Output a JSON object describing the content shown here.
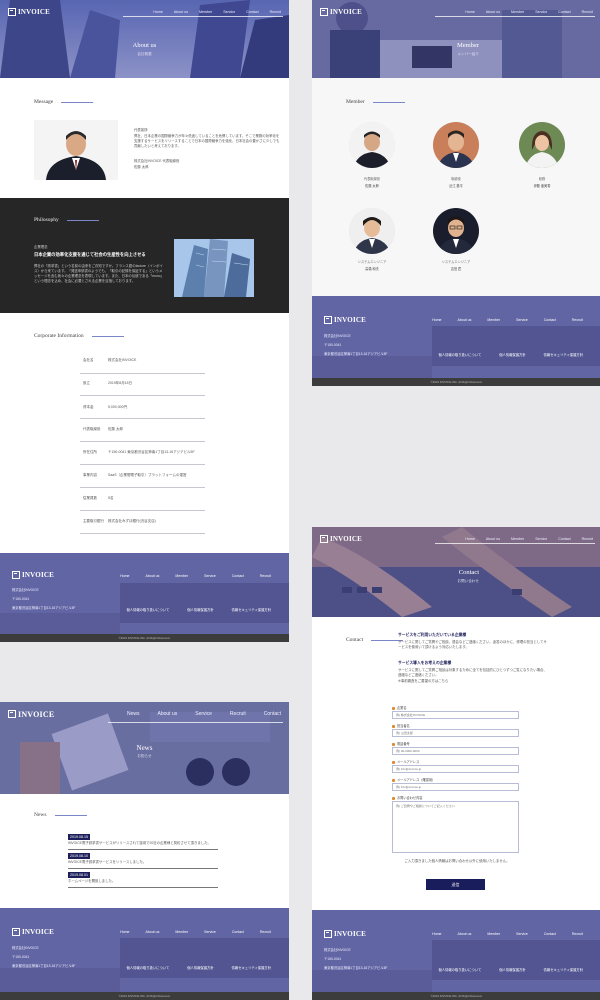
{
  "brand": {
    "logo": "INVOICE"
  },
  "nav": [
    "Home",
    "About us",
    "Member",
    "Service",
    "Contact",
    "Recruit"
  ],
  "nav_news": [
    "News",
    "About us",
    "Service",
    "Recruit",
    "Contact"
  ],
  "about": {
    "hero_title": "About us",
    "hero_sub": "会社概要",
    "message_heading": "Message",
    "message_paragraphs": [
      "代表挨拶",
      "弊社、日本企業の国際競争力が年々低迷していることを危惧しています。そこで業務の効率化を支援するサービスをリリースすることで日本の国際競争力を強化、日本社会の豊かさに少しでも貢献したいと考えております。",
      "株式会社INVOICE 代表取締役",
      "佐藤 太郎"
    ],
    "philosophy_heading": "Philosophy",
    "philosophy_label": "企業理念",
    "philosophy_title": "日本企業の効率化支援を通じて社会の生産性を向上させる",
    "philosophy_body": "弊社の「請求書」という名前の由来をご存知ですか。フランス語のfacture（インボイス）から来ています。「発送申請書のようでも、「取引の記録を保証する」というメッセージを含む我々の企業理念を表現しています。また、日本の伝統である「mono」という理念を込め、社会に必要とされる企業を目指しております。",
    "corp_heading": "Corporate Information",
    "corp_rows": [
      {
        "label": "会社名",
        "value": "株式会社INVOICE"
      },
      {
        "label": "設立",
        "value": "2019年8月15日"
      },
      {
        "label": "資本金",
        "value": "5,000,000円"
      },
      {
        "label": "代表取締役",
        "value": "佐藤 太郎"
      },
      {
        "label": "所在住所",
        "value": "〒150-0041 東京都渋谷区神南1丁目13-16アジアビル5F"
      },
      {
        "label": "事業内容",
        "value": "SaaS（企業間電子取引）プラットフォームの運営"
      },
      {
        "label": "従業員数",
        "value": "5名"
      },
      {
        "label": "主要取引銀行",
        "value": "株式会社みずほ銀行(渋谷支店)"
      }
    ]
  },
  "member": {
    "hero_title": "Member",
    "hero_sub": "メンバー紹介",
    "heading": "Member",
    "people": [
      {
        "role": "代表取締役",
        "name": "佐藤 太郎"
      },
      {
        "role": "取締役",
        "name": "近江 基平"
      },
      {
        "role": "総務",
        "name": "伊藤 亜美香"
      },
      {
        "role": "システムエンジニア",
        "name": "高橋 和夫"
      },
      {
        "role": "システムエンジニア",
        "name": "吉田 匠"
      }
    ]
  },
  "news": {
    "hero_title": "News",
    "hero_sub": "お知らせ",
    "heading": "News",
    "items": [
      {
        "date": "2019.08.15",
        "text": "INVOICE電子請求書サービスがリリースされて運用で20社の企業様と契約させて頂きました。"
      },
      {
        "date": "2019.08.10",
        "text": "INVOICE電子請求書サービスをリリースしました。"
      },
      {
        "date": "2019.08.01",
        "text": "ホームページを開設しました。"
      }
    ]
  },
  "contact": {
    "hero_title": "Contact",
    "hero_sub": "お問い合わせ",
    "heading": "Contact",
    "lead_title_1": "サービスをご利用いただいている企業様",
    "lead_body_1": "サービスに関してご質問やご相談、退会などご連絡ください。返答のほかに、修理の担当としてサービスを使用いて頂けるよう対応いたします。",
    "lead_title_2": "サービス導入をお考えの企業様",
    "lead_body_2": "サービスに関してご質問ご相談は対象するために全てを包括的にひとつずつご覧になりたい場合、連絡などご連絡ください。",
    "lead_body_3": "※事前審査をご要望の方はこちら",
    "fields": [
      {
        "label": "企業名",
        "placeholder": "例) 株式会社INVOICE"
      },
      {
        "label": "担当者名",
        "placeholder": "例) 山田太郎"
      },
      {
        "label": "電話番号",
        "placeholder": "例) 00-0000-0000"
      },
      {
        "label": "メールアドレス",
        "placeholder": "例) info@invoice.jp"
      },
      {
        "label": "メールアドレス（確認用）",
        "placeholder": "例) info@invoice.jp"
      }
    ],
    "message_label": "お問い合わせ内容",
    "message_placeholder": "例) ご質問やご相談についてご記入ください",
    "privacy_note": "ご入力頂きました個人情報はお問い合わせ以外に使用いたしません。",
    "submit_label": "送信"
  },
  "footer": {
    "company": "株式会社INVOICE",
    "postal": "〒150-0041",
    "address": "東京都渋谷区神南1丁目13-16アジアビル5F",
    "links": [
      "個人情報の取り扱いについて",
      "個人情報保護方針",
      "情報セキュリティ保護方針"
    ],
    "copyright": "©2019 INVOICE INC. All Right Reserved."
  }
}
